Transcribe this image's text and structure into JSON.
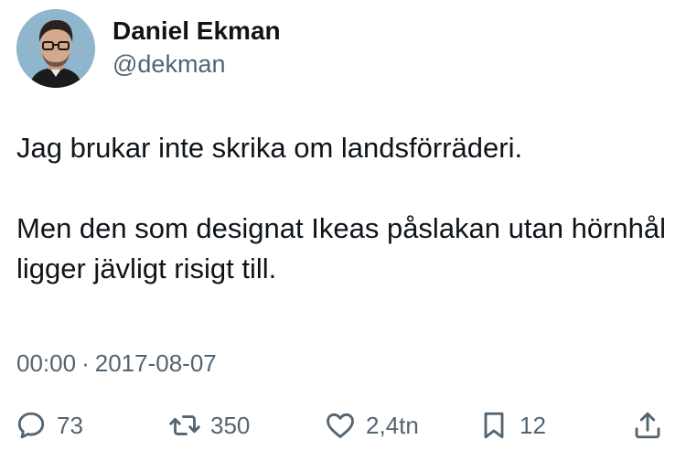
{
  "author": {
    "display_name": "Daniel Ekman",
    "handle": "@dekman"
  },
  "tweet": {
    "paragraph_1": "Jag brukar inte skrika om landsförräderi.",
    "paragraph_2": "Men den som designat Ikeas påslakan utan hörnhål ligger jävligt risigt till.",
    "time": "00:00",
    "separator": "·",
    "date": "2017-08-07"
  },
  "actions": {
    "reply": {
      "icon": "reply-icon",
      "count": "73"
    },
    "retweet": {
      "icon": "retweet-icon",
      "count": "350"
    },
    "like": {
      "icon": "heart-icon",
      "count": "2,4tn"
    },
    "bookmark": {
      "icon": "bookmark-icon",
      "count": "12"
    },
    "share": {
      "icon": "share-icon"
    }
  },
  "colors": {
    "text": "#0f1419",
    "secondary": "#536471",
    "avatar_bg": "#8fb6cc"
  }
}
